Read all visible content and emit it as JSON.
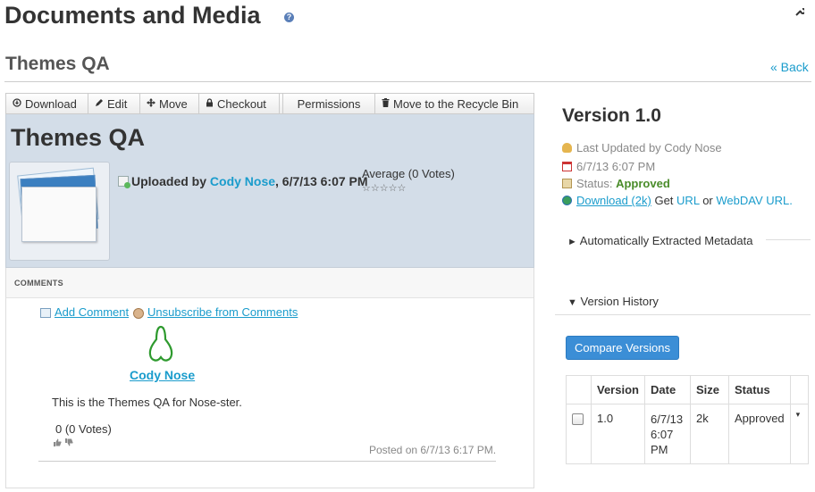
{
  "portlet": {
    "title": "Documents and Media",
    "help_glyph": "?"
  },
  "header": {
    "title": "Themes QA",
    "back_label": "« Back"
  },
  "toolbar": {
    "items": [
      {
        "label": "Download",
        "icon": "download-icon"
      },
      {
        "label": "Edit",
        "icon": "edit-icon"
      },
      {
        "label": "Move",
        "icon": "move-icon"
      },
      {
        "label": "Checkout",
        "icon": "lock-icon"
      },
      {
        "label": "Permissions",
        "icon": ""
      },
      {
        "label": "Move to the Recycle Bin",
        "icon": "trash-icon"
      }
    ]
  },
  "document": {
    "title": "Themes QA",
    "uploaded_prefix": "Uploaded by",
    "uploaded_by": "Cody Nose",
    "uploaded_date": ", 6/7/13 6:07 PM",
    "rating_label": "Average (0 Votes)",
    "stars": "☆☆☆☆☆"
  },
  "comments": {
    "section_label": "COMMENTS",
    "add_comment": "Add Comment",
    "unsubscribe": "Unsubscribe from Comments",
    "author": "Cody Nose",
    "body": "This is the Themes QA for Nose-ster.",
    "votes": "0 (0 Votes)",
    "posted_on": "Posted on 6/7/13 6:17 PM."
  },
  "sidebar": {
    "version_title": "Version 1.0",
    "last_updated": "Last Updated by Cody Nose",
    "date": "6/7/13 6:07 PM",
    "status_label": "Status:",
    "status_value": "Approved",
    "download_link": "Download (2k)",
    "get_text": "Get",
    "url_link": "URL",
    "or_text": "or",
    "webdav_link": "WebDAV URL.",
    "metadata_section": "Automatically Extracted Metadata",
    "metadata_toggle": "►",
    "history_section": "Version History",
    "history_toggle": "▼",
    "compare_button": "Compare Versions"
  },
  "version_table": {
    "headers": [
      "",
      "Version",
      "Date",
      "Size",
      "Status",
      ""
    ],
    "rows": [
      {
        "version": "1.0",
        "date": "6/7/13 6:07 PM",
        "size": "2k",
        "status": "Approved"
      }
    ]
  },
  "colors": {
    "link": "#1a9ccc",
    "panel": "#d3dde8",
    "approved": "#4a8c2a",
    "button": "#3b8ed6"
  }
}
